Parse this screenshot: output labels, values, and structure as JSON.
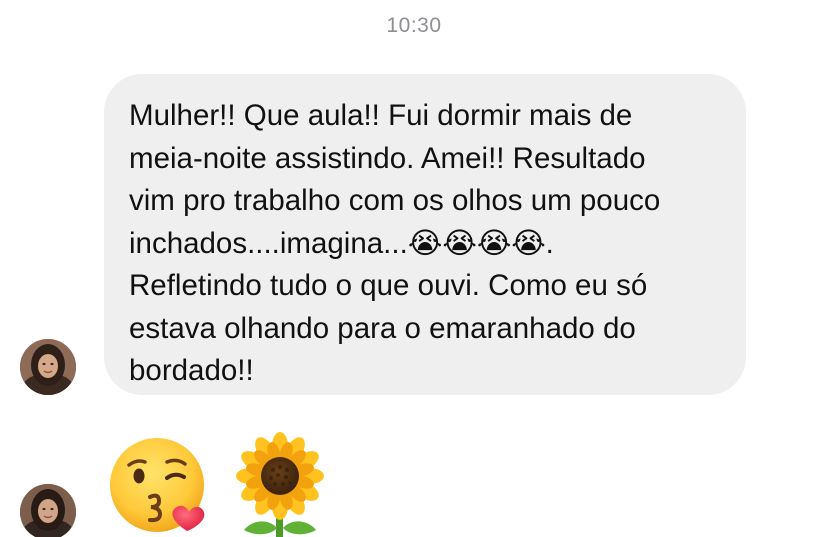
{
  "conversation": {
    "timestamp": "10:30",
    "messages": [
      {
        "type": "text",
        "text": "Mulher!! Que aula!! Fui dormir mais de\nmeia-noite assistindo. Amei!! Resultado\nvim pro trabalho com os olhos um pouco\ninchados....imagina...😭😭😭😭.\nRefletindo tudo o que ouvi. Como eu só\nestava olhando para o emaranhado do\nbordado!!"
      },
      {
        "type": "emoji",
        "emojis": [
          "face-blowing-a-kiss",
          "sunflower"
        ]
      }
    ]
  },
  "colors": {
    "bubble_background": "#efefef",
    "timestamp_text": "#8e8e93",
    "message_text": "#111111"
  }
}
